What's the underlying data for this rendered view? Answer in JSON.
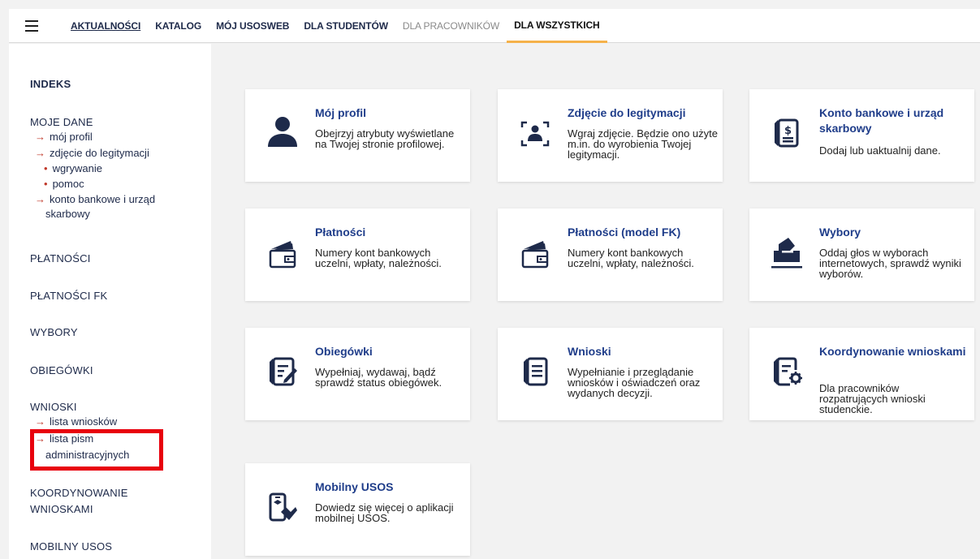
{
  "nav": {
    "items": [
      "AKTUALNOŚCI",
      "KATALOG",
      "MÓJ USOSWEB",
      "DLA STUDENTÓW",
      "DLA PRACOWNIKÓW",
      "DLA WSZYSTKICH"
    ]
  },
  "sidebar": {
    "indeks": "INDEKS",
    "moje_dane": "MOJE DANE",
    "moj_profil": "mój profil",
    "zdjecie": "zdjęcie do legitymacji",
    "wgrywanie": "wgrywanie",
    "pomoc": "pomoc",
    "konto_line1": "konto bankowe i urząd",
    "konto_line2": "skarbowy",
    "platnosci": "PŁATNOŚCI",
    "platnosci_fk": "PŁATNOŚCI FK",
    "wybory": "WYBORY",
    "obiegowki": "OBIEGÓWKI",
    "wnioski": "WNIOSKI",
    "lista_wnioskow": "lista wniosków",
    "lista_pism_line1": "lista pism",
    "lista_pism_line2": "administracyjnych",
    "koordynowanie_line1": "KOORDYNOWANIE",
    "koordynowanie_line2": "WNIOSKAMI",
    "mobilny": "MOBILNY USOS",
    "arrow": "→",
    "dot": "•"
  },
  "cards": [
    {
      "title": "Mój profil",
      "desc": "Obejrzyj atrybuty wyświetlane na Twojej stronie profilowej.",
      "icon": "user-icon"
    },
    {
      "title": "Zdjęcie do legitymacji",
      "desc": "Wgraj zdjęcie. Będzie ono użyte m.in. do wyrobienia Twojej legitymacji.",
      "icon": "photo-id-icon"
    },
    {
      "title": "Konto bankowe i urząd skarbowy",
      "desc": "Dodaj lub uaktualnij dane.",
      "icon": "bank-document-icon"
    },
    {
      "title": "Płatności",
      "desc": "Numery kont bankowych uczelni, wpłaty, należności.",
      "icon": "wallet-icon"
    },
    {
      "title": "Płatności (model FK)",
      "desc": "Numery kont bankowych uczelni, wpłaty, należności.",
      "icon": "wallet-icon"
    },
    {
      "title": "Wybory",
      "desc": "Oddaj głos w wyborach internetowych, sprawdź wyniki wyborów.",
      "icon": "ballot-box-icon"
    },
    {
      "title": "Obiegówki",
      "desc": "Wypełniaj, wydawaj, bądź sprawdź status obiegówek.",
      "icon": "form-edit-icon"
    },
    {
      "title": "Wnioski",
      "desc": "Wypełnianie i przeglądanie wniosków i oświadczeń oraz wydanych decyzji.",
      "icon": "document-list-icon"
    },
    {
      "title": "Koordynowanie wnioskami",
      "desc": "Dla pracowników rozpatrujących wnioski studenckie.",
      "icon": "document-gear-icon"
    },
    {
      "title": "Mobilny USOS",
      "desc": "Dowiedz się więcej o aplikacji mobilnej USOS.",
      "icon": "mobile-app-icon"
    }
  ],
  "colors": {
    "accent": "#f5b14a",
    "icon": "#1e2a4a",
    "title": "#1f3d8a",
    "highlight": "#e8000d",
    "arrow": "#c0392b"
  }
}
